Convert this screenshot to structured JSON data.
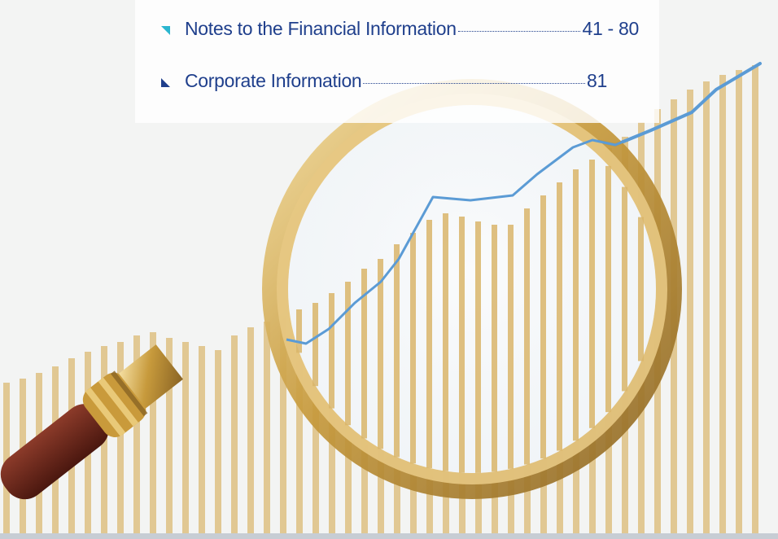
{
  "toc": {
    "entries": [
      {
        "title": "Notes to the Financial Information",
        "pages": "41 - 80",
        "bullet_color": "#2bb6cf"
      },
      {
        "title": "Corporate Information",
        "pages": "81",
        "bullet_color": "#1f3f8c"
      }
    ]
  },
  "background": {
    "description_colors": {
      "bars": "#d9b56a",
      "trend_line": "#5b9bd5",
      "lens_frame": "#c9a048",
      "handle": "#6e2a1e"
    },
    "illustration": "magnifying-glass-over-bar-chart"
  }
}
